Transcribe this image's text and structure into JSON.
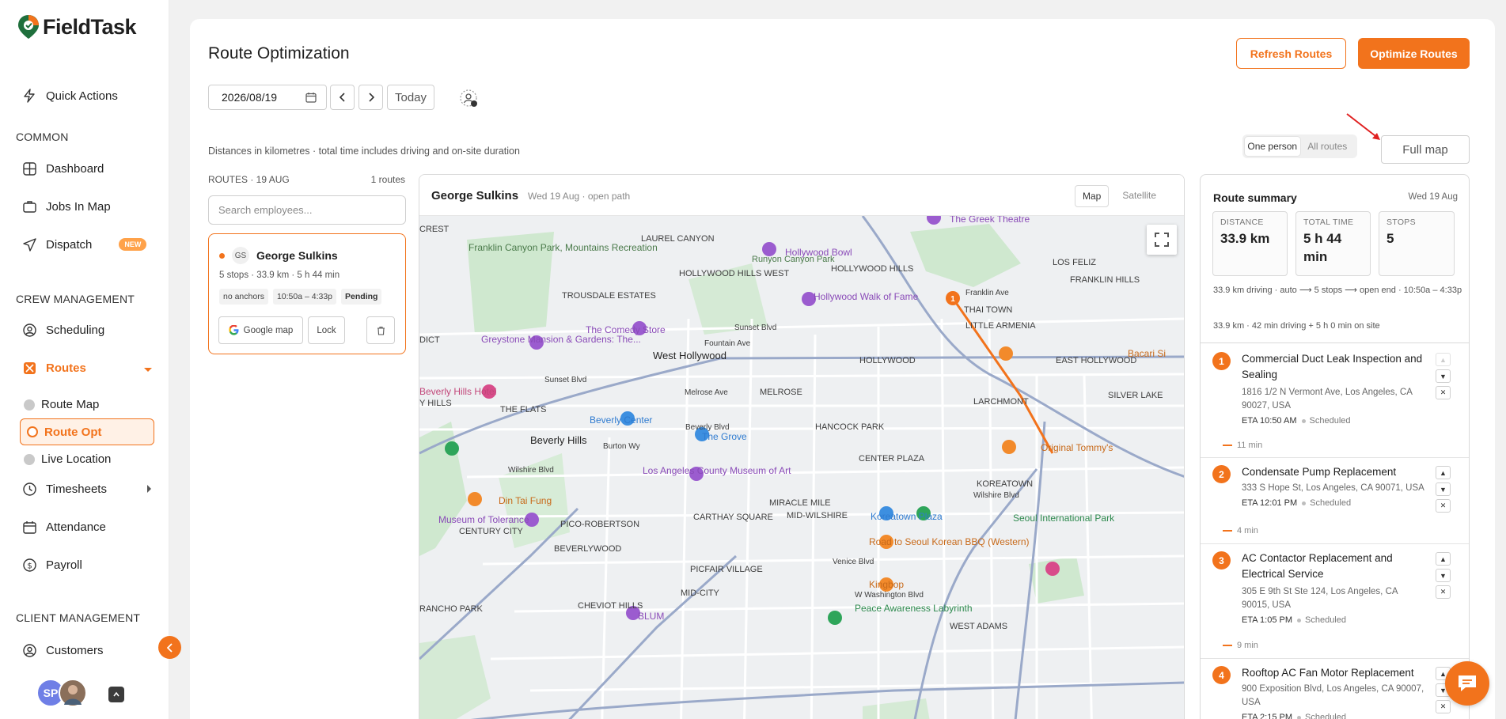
{
  "app": {
    "name": "FieldTask"
  },
  "sidebar": {
    "quick_actions": "Quick Actions",
    "sections": {
      "common": "COMMON",
      "crew": "CREW MANAGEMENT",
      "client": "CLIENT MANAGEMENT"
    },
    "items": {
      "dashboard": "Dashboard",
      "jobs_in_map": "Jobs In Map",
      "dispatch": "Dispatch",
      "dispatch_badge": "NEW",
      "scheduling": "Scheduling",
      "routes": "Routes",
      "route_map": "Route Map",
      "route_opt": "Route Opt",
      "live_location": "Live Location",
      "timesheets": "Timesheets",
      "attendance": "Attendance",
      "payroll": "Payroll",
      "customers": "Customers"
    },
    "user_initials": "SP"
  },
  "header": {
    "title": "Route Optimization",
    "refresh_label": "Refresh Routes",
    "optimize_label": "Optimize Routes"
  },
  "toolbar": {
    "date_value": "2026/08/19",
    "today_label": "Today",
    "note": "Distances in kilometres · total time includes driving and on-site duration",
    "view_one": "One person",
    "view_all": "All routes",
    "full_map": "Full map"
  },
  "routes": {
    "heading": "ROUTES · 19 AUG",
    "count": "1 routes",
    "search_placeholder": "Search employees...",
    "card": {
      "initials": "GS",
      "name": "George Sulkins",
      "meta": "5 stops · 33.9 km · 5 h 44 min",
      "tags": [
        "no anchors",
        "10:50a – 4:33p",
        "Pending"
      ],
      "google_map": "Google map",
      "lock": "Lock"
    }
  },
  "map": {
    "employee": "George Sulkins",
    "subtitle": "Wed 19 Aug · open path",
    "mode_map": "Map",
    "mode_satellite": "Satellite",
    "labels": [
      "LAUREL CANYON",
      "Runyon Canyon Park",
      "Hollywood Bowl",
      "The Greek Theatre",
      "LOS FELIZ",
      "Franklin Canyon Park, Mountains Recreation",
      "HOLLYWOOD HILLS WEST",
      "HOLLYWOOD HILLS",
      "FRANKLIN HILLS",
      "TROUSDALE ESTATES",
      "Hollywood Walk of Fame",
      "Franklin Ave",
      "THAI TOWN",
      "Sunset Blvd",
      "LITTLE ARMENIA",
      "The Comedy Store",
      "Greystone Mansion & Gardens: The...",
      "Fountain Ave",
      "West Hollywood",
      "HOLLYWOOD",
      "EAST HOLLYWOOD",
      "Bacari Si",
      "Sunset Blvd",
      "Melrose Ave",
      "MELROSE",
      "LARCHMONT",
      "SILVER LAKE",
      "Beverly Hills Hotel",
      "THE FLATS",
      "Beverly Center",
      "Beverly Blvd",
      "HANCOCK PARK",
      "The Grove",
      "Beverly Hills",
      "Burton Wy",
      "Original Tommy's",
      "Wilshire Blvd",
      "Los Angeles County Museum of Art",
      "CENTER PLAZA",
      "KOREATOWN",
      "Wilshire Blvd",
      "Din Tai Fung",
      "MIRACLE MILE",
      "MID-WILSHIRE",
      "Museum of Tolerance",
      "CENTURY CITY",
      "PICO-ROBERTSON",
      "CARTHAY SQUARE",
      "Koreatown Plaza",
      "Seoul International Park",
      "Road to Seoul Korean BBQ (Western)",
      "BEVERLYWOOD",
      "PICFAIR VILLAGE",
      "Venice Blvd",
      "Kingbop",
      "MID-CITY",
      "W Washington Blvd",
      "CHEVIOT HILLS",
      "RANCHO PARK",
      "BLUM",
      "Peace Awareness Labyrinth",
      "WEST ADAMS",
      "DICT",
      "Y HILLS",
      "CREST"
    ],
    "marker": "1"
  },
  "summary": {
    "title": "Route summary",
    "date": "Wed 19 Aug",
    "stats": [
      {
        "label": "DISTANCE",
        "value": "33.9 km"
      },
      {
        "label": "TOTAL TIME",
        "value": "5 h 44 min"
      },
      {
        "label": "STOPS",
        "value": "5"
      }
    ],
    "line1": "33.9 km driving · auto ⟶ 5 stops ⟶ open end · 10:50a – 4:33p",
    "line2": "33.9 km · 42 min driving + 5 h 0 min on site",
    "stops": [
      {
        "num": "1",
        "title": "Commercial Duct Leak Inspection and Sealing",
        "addr": "1816 1/2 N Vermont Ave, Los Angeles, CA 90027, USA",
        "eta": "ETA 10:50 AM",
        "status": "Scheduled",
        "leg": "11 min"
      },
      {
        "num": "2",
        "title": "Condensate Pump Replacement",
        "addr": "333 S Hope St, Los Angeles, CA 90071, USA",
        "eta": "ETA 12:01 PM",
        "status": "Scheduled",
        "leg": "4 min"
      },
      {
        "num": "3",
        "title": "AC Contactor Replacement and Electrical Service",
        "addr": "305 E 9th St Ste 124, Los Angeles, CA 90015, USA",
        "eta": "ETA 1:05 PM",
        "status": "Scheduled",
        "leg": "9 min"
      },
      {
        "num": "4",
        "title": "Rooftop AC Fan Motor Replacement",
        "addr": "900 Exposition Blvd, Los Angeles, CA 90007, USA",
        "eta": "ETA 2:15 PM",
        "status": "Scheduled",
        "leg": ""
      }
    ]
  },
  "colors": {
    "accent": "#f2731c",
    "map_bg": "#eef0f2",
    "park": "#c8e6c9",
    "water_road": "#9aa9c9"
  }
}
